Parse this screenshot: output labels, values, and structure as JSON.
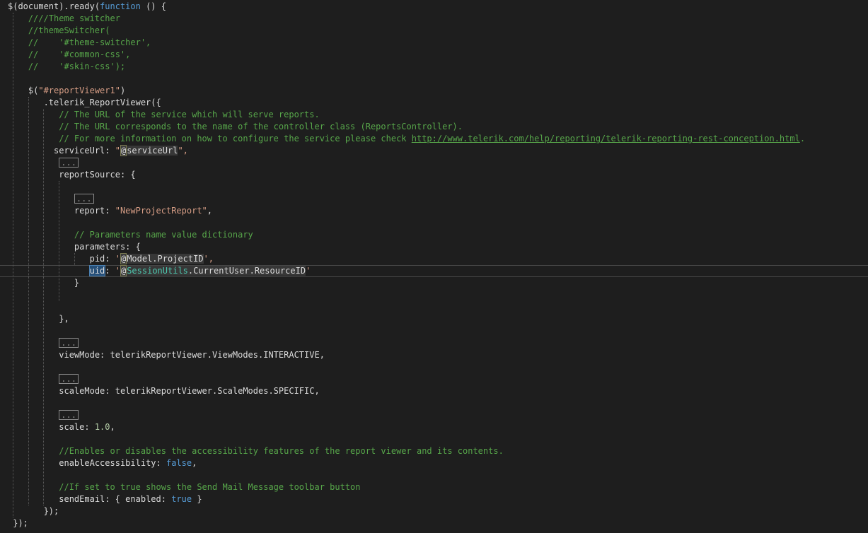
{
  "editor": {
    "current_line": 22,
    "lines": [
      {
        "i": 0,
        "tokens": [
          {
            "t": "$(document).ready(",
            "k": "plain"
          },
          {
            "t": "function",
            "k": "kw"
          },
          {
            "t": " () {",
            "k": "plain"
          }
        ]
      },
      {
        "i": 4,
        "tokens": [
          {
            "t": "////Theme switcher",
            "k": "comment"
          }
        ]
      },
      {
        "i": 4,
        "tokens": [
          {
            "t": "//themeSwitcher(",
            "k": "comment"
          }
        ]
      },
      {
        "i": 4,
        "tokens": [
          {
            "t": "//    '#theme-switcher',",
            "k": "comment"
          }
        ]
      },
      {
        "i": 4,
        "tokens": [
          {
            "t": "//    '#common-css',",
            "k": "comment"
          }
        ]
      },
      {
        "i": 4,
        "tokens": [
          {
            "t": "//    '#skin-css');",
            "k": "comment"
          }
        ]
      },
      {
        "i": 0,
        "tokens": []
      },
      {
        "i": 4,
        "tokens": [
          {
            "t": "$(",
            "k": "plain"
          },
          {
            "t": "\"#reportViewer1\"",
            "k": "str"
          },
          {
            "t": ")",
            "k": "plain"
          }
        ]
      },
      {
        "i": 7,
        "tokens": [
          {
            "t": ".telerik_ReportViewer({",
            "k": "plain"
          }
        ]
      },
      {
        "i": 10,
        "tokens": [
          {
            "t": "// The URL of the service which will serve reports.",
            "k": "comment"
          }
        ]
      },
      {
        "i": 10,
        "tokens": [
          {
            "t": "// The URL corresponds to the name of the controller class (ReportsController).",
            "k": "comment"
          }
        ]
      },
      {
        "i": 10,
        "tokens": [
          {
            "t": "// For more information on how to configure the service please check ",
            "k": "comment"
          },
          {
            "t": "http://www.telerik.com/help/reporting/telerik-reporting-rest-conception.html",
            "k": "link"
          },
          {
            "t": ".",
            "k": "comment"
          }
        ]
      },
      {
        "i": 9,
        "tokens": [
          {
            "t": "serviceUrl: ",
            "k": "plain"
          },
          {
            "t": "\"",
            "k": "str"
          },
          {
            "t": "@",
            "k": "razor"
          },
          {
            "t": "serviceUrl",
            "k": "razor-expr"
          },
          {
            "t": "\",",
            "k": "str"
          }
        ]
      },
      {
        "i": 10,
        "tokens": [
          {
            "t": "...",
            "k": "fold"
          }
        ]
      },
      {
        "i": 10,
        "tokens": [
          {
            "t": "reportSource: {",
            "k": "plain"
          }
        ]
      },
      {
        "i": 0,
        "tokens": []
      },
      {
        "i": 13,
        "tokens": [
          {
            "t": "...",
            "k": "fold"
          }
        ]
      },
      {
        "i": 13,
        "tokens": [
          {
            "t": "report: ",
            "k": "plain"
          },
          {
            "t": "\"NewProjectReport\"",
            "k": "str"
          },
          {
            "t": ",",
            "k": "plain"
          }
        ]
      },
      {
        "i": 0,
        "tokens": []
      },
      {
        "i": 13,
        "tokens": [
          {
            "t": "// Parameters name value dictionary",
            "k": "comment"
          }
        ]
      },
      {
        "i": 13,
        "tokens": [
          {
            "t": "parameters: {",
            "k": "plain"
          }
        ]
      },
      {
        "i": 16,
        "tokens": [
          {
            "t": "pid: ",
            "k": "plain"
          },
          {
            "t": "'",
            "k": "str"
          },
          {
            "t": "@",
            "k": "razor"
          },
          {
            "t": "Model.ProjectID",
            "k": "razor-expr"
          },
          {
            "t": "',",
            "k": "str"
          }
        ]
      },
      {
        "i": 16,
        "tokens": [
          {
            "t": "uid",
            "k": "sel"
          },
          {
            "t": ": ",
            "k": "plain"
          },
          {
            "t": "'",
            "k": "str"
          },
          {
            "t": "@",
            "k": "razor"
          },
          {
            "t": "SessionUtils",
            "k": "razor-dim"
          },
          {
            "t": ".CurrentUser.ResourceID",
            "k": "razor-expr"
          },
          {
            "t": "'",
            "k": "str"
          }
        ]
      },
      {
        "i": 13,
        "tokens": [
          {
            "t": "}",
            "k": "plain"
          }
        ]
      },
      {
        "i": 0,
        "tokens": []
      },
      {
        "i": 0,
        "tokens": []
      },
      {
        "i": 10,
        "tokens": [
          {
            "t": "},",
            "k": "plain"
          }
        ]
      },
      {
        "i": 0,
        "tokens": []
      },
      {
        "i": 10,
        "tokens": [
          {
            "t": "...",
            "k": "fold"
          }
        ]
      },
      {
        "i": 10,
        "tokens": [
          {
            "t": "viewMode: telerikReportViewer.ViewModes.INTERACTIVE,",
            "k": "plain"
          }
        ]
      },
      {
        "i": 0,
        "tokens": []
      },
      {
        "i": 10,
        "tokens": [
          {
            "t": "...",
            "k": "fold"
          }
        ]
      },
      {
        "i": 10,
        "tokens": [
          {
            "t": "scaleMode: telerikReportViewer.ScaleModes.SPECIFIC,",
            "k": "plain"
          }
        ]
      },
      {
        "i": 0,
        "tokens": []
      },
      {
        "i": 10,
        "tokens": [
          {
            "t": "...",
            "k": "fold"
          }
        ]
      },
      {
        "i": 10,
        "tokens": [
          {
            "t": "scale: ",
            "k": "plain"
          },
          {
            "t": "1.0",
            "k": "num"
          },
          {
            "t": ",",
            "k": "plain"
          }
        ]
      },
      {
        "i": 0,
        "tokens": []
      },
      {
        "i": 10,
        "tokens": [
          {
            "t": "//Enables or disables the accessibility features of the report viewer and its contents.",
            "k": "comment"
          }
        ]
      },
      {
        "i": 10,
        "tokens": [
          {
            "t": "enableAccessibility: ",
            "k": "plain"
          },
          {
            "t": "false",
            "k": "kw"
          },
          {
            "t": ",",
            "k": "plain"
          }
        ]
      },
      {
        "i": 0,
        "tokens": []
      },
      {
        "i": 10,
        "tokens": [
          {
            "t": "//If set to true shows the Send Mail Message toolbar button",
            "k": "comment"
          }
        ]
      },
      {
        "i": 10,
        "tokens": [
          {
            "t": "sendEmail: { enabled: ",
            "k": "plain"
          },
          {
            "t": "true",
            "k": "kw"
          },
          {
            "t": " }",
            "k": "plain"
          }
        ]
      },
      {
        "i": 7,
        "tokens": [
          {
            "t": "});",
            "k": "plain"
          }
        ]
      },
      {
        "i": 1,
        "tokens": [
          {
            "t": "});",
            "k": "plain"
          }
        ]
      }
    ]
  }
}
